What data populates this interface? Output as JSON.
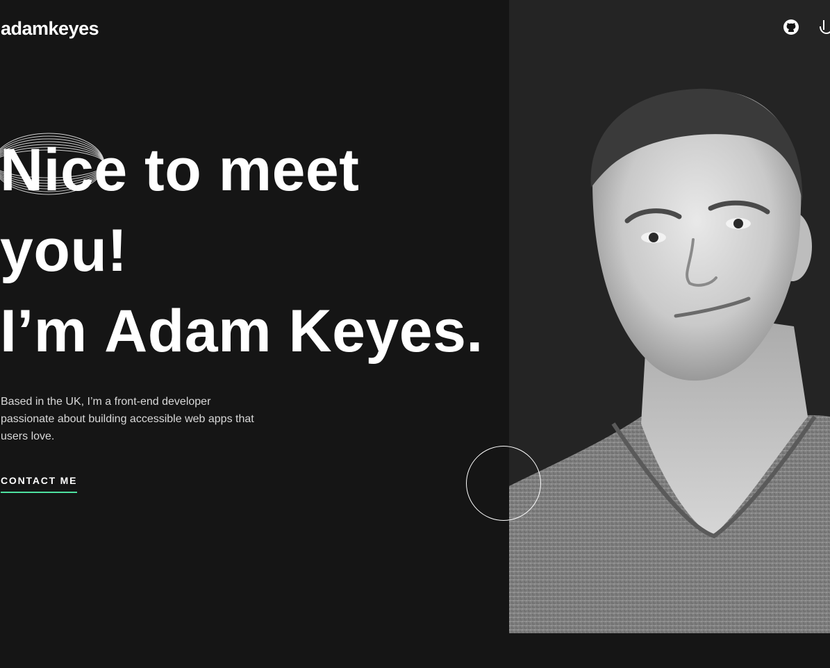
{
  "header": {
    "logo": "adamkeyes",
    "social": [
      {
        "icon": "github-icon"
      },
      {
        "icon": "frontend-mentor-icon"
      }
    ]
  },
  "hero": {
    "headline_line1": "Nice to meet",
    "headline_line2": "you!",
    "headline_line3_prefix": "I’m ",
    "headline_name": "Adam Keyes",
    "headline_line3_suffix": ".",
    "intro": "Based in the UK, I’m a front-end developer passionate about building accessible web apps that users love.",
    "contact_label": "CONTACT ME"
  },
  "colors": {
    "background": "#151515",
    "photo_panel": "#242424",
    "accent": "#4ee1a0",
    "text": "#ffffff",
    "muted_text": "#d9d9d9"
  }
}
